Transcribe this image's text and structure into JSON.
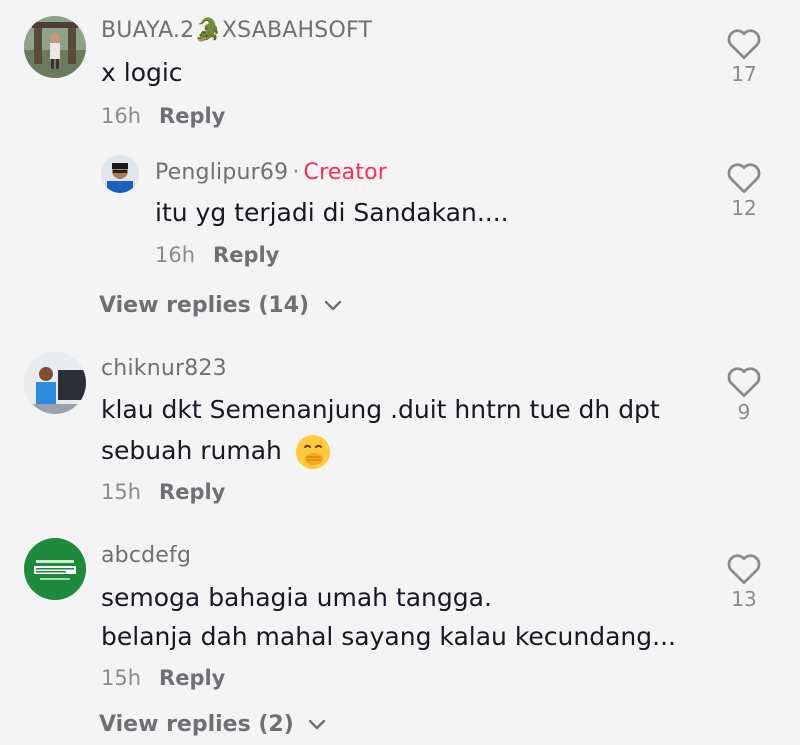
{
  "comments": [
    {
      "username": "BUAYA.2🐊XSABAHSOFT",
      "text": "x logic",
      "time": "16h",
      "reply_label": "Reply",
      "likes": "17",
      "replies": [
        {
          "username": "Penglipur69",
          "creator_label": "Creator",
          "text": "itu yg terjadi di Sandakan....",
          "time": "16h",
          "reply_label": "Reply",
          "likes": "12"
        }
      ],
      "view_replies": "View replies (14)"
    },
    {
      "username": "chiknur823",
      "text_line1": "klau dkt Semenanjung .duit hntrn tue dh dpt",
      "text_line2": "sebuah rumah",
      "time": "15h",
      "reply_label": "Reply",
      "likes": "9"
    },
    {
      "username": "abcdefg",
      "text_line1": "semoga bahagia umah tangga.",
      "text_line2": "belanja dah mahal sayang kalau kecundang...",
      "time": "15h",
      "reply_label": "Reply",
      "likes": "13",
      "view_replies": "View replies (2)"
    }
  ],
  "colors": {
    "background": "#f4f4f4",
    "creator": "#fe2c55",
    "secondary_text": "#8a8b91"
  },
  "icons": {
    "like": "heart-outline-icon",
    "expand": "chevron-down-icon",
    "emoji": "face-hand-over-mouth-emoji"
  }
}
